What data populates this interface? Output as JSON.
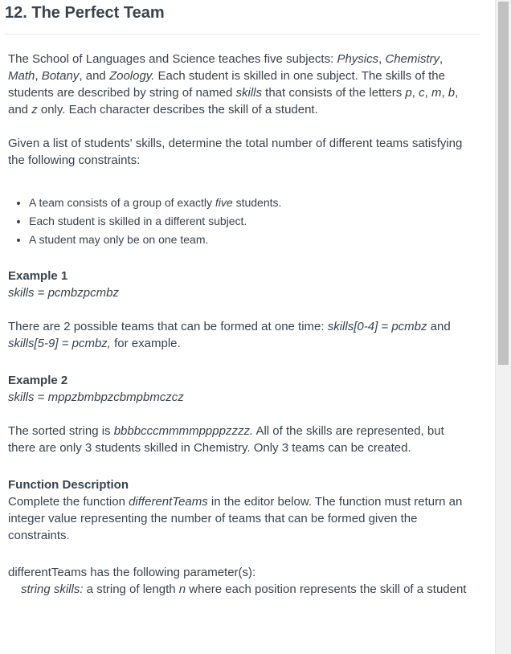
{
  "problem": {
    "title": "12. The Perfect Team",
    "intro": {
      "t1": "The School of Languages and Science teaches five subjects: ",
      "physics": "Physics",
      "c1": ", ",
      "chemistry": "Chemistry",
      "c2": ", ",
      "math": "Math",
      "c3": ", ",
      "botany": "Botany",
      "c4": ", and ",
      "zoology": "Zoology.",
      "t2": " Each student is skilled in one subject. The skills of the students are described by string of named ",
      "skills": "skills",
      "t3": " that consists of the letters ",
      "p": "p",
      "c5": ", ",
      "c": "c",
      "c6": ", ",
      "m": "m",
      "c7": ", ",
      "b": "b",
      "c8": ", and ",
      "z": "z",
      "t4": " only. Each character describes the skill of a student."
    },
    "task": "Given a list of students' skills, determine the total number of different teams satisfying the following constraints:",
    "constraints": {
      "c1_pre": "A team consists of a group of exactly ",
      "c1_em": "five",
      "c1_post": " students.",
      "c2": "Each student is skilled in a different subject.",
      "c3": "A student may only be on one team."
    },
    "example1": {
      "heading": "Example 1",
      "input": "skills = pcmbzpcmbz",
      "expl_pre": "There are 2 possible teams that can be formed at one time: ",
      "expl_em1": "skills[0-4] = pcmbz",
      "expl_mid": " and ",
      "expl_em2": "skills[5-9] = pcmbz,",
      "expl_post": " for example."
    },
    "example2": {
      "heading": "Example 2",
      "input": "skills = mppzbmbpzcbmpbmczcz",
      "expl_pre": "The sorted string is ",
      "expl_em": "bbbbcccmmmmppppzzzz.",
      "expl_post": " All of the skills are represented, but there are only 3 students skilled in Chemistry. Only 3 teams can be created."
    },
    "function_description": {
      "heading": "Function Description",
      "pre": "Complete the function ",
      "fn": "differentTeams",
      "post": " in the editor below. The function must return an integer value representing the number of teams that can be formed given the constraints."
    },
    "params": {
      "header": "differentTeams has the following parameter(s):",
      "p_em": "string skills:",
      "p_mid": " a string of length ",
      "p_n": "n",
      "p_post": " where each position represents the skill of a student"
    }
  }
}
